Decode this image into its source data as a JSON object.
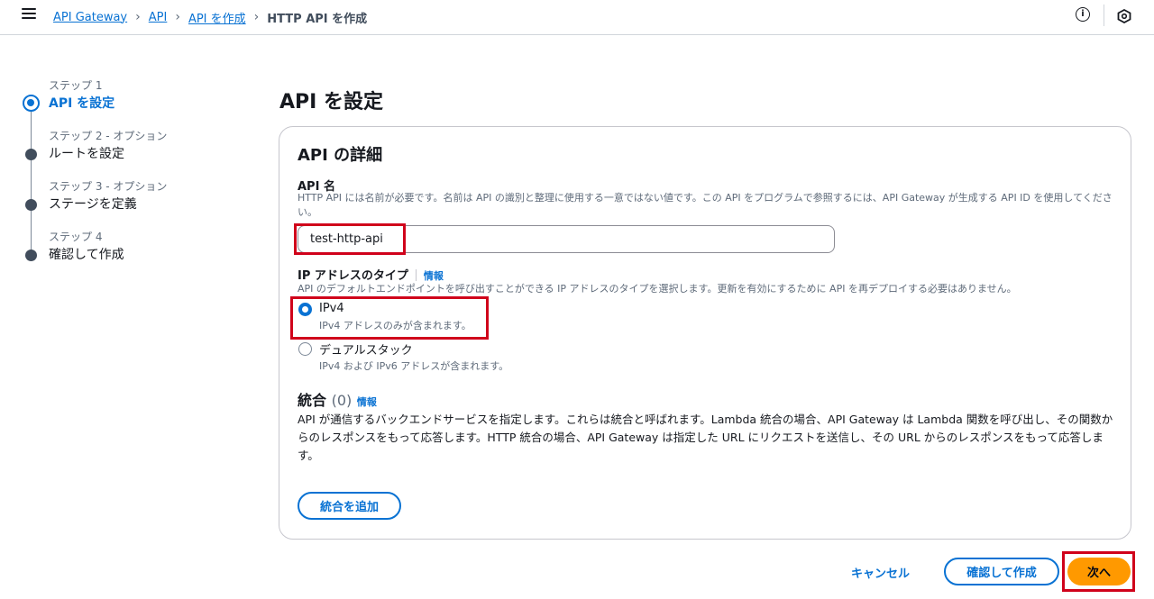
{
  "breadcrumb": {
    "items": [
      "API Gateway",
      "API",
      "API を作成"
    ],
    "current": "HTTP API を作成",
    "separator": "›"
  },
  "topbar": {
    "info_glyph": "i"
  },
  "steps": [
    {
      "sub": "ステップ 1",
      "title": "API を設定",
      "active": true
    },
    {
      "sub": "ステップ 2 - オプション",
      "title": "ルートを設定",
      "active": false
    },
    {
      "sub": "ステップ 3 - オプション",
      "title": "ステージを定義",
      "active": false
    },
    {
      "sub": "ステップ 4",
      "title": "確認して作成",
      "active": false
    }
  ],
  "main": {
    "title": "API を設定",
    "card": {
      "title": "API の詳細",
      "api_name": {
        "label": "API 名",
        "description": "HTTP API には名前が必要です。名前は API の識別と整理に使用する一意ではない値です。この API をプログラムで参照するには、API Gateway が生成する API ID を使用してください。",
        "value": "test-http-api"
      },
      "ip_type": {
        "label": "IP アドレスのタイプ",
        "info": "情報",
        "description": "API のデフォルトエンドポイントを呼び出すことができる IP アドレスのタイプを選択します。更新を有効にするために API を再デプロイする必要はありません。",
        "options": [
          {
            "label": "IPv4",
            "description": "IPv4 アドレスのみが含まれます。",
            "checked": true
          },
          {
            "label": "デュアルスタック",
            "description": "IPv4 および IPv6 アドレスが含まれます。",
            "checked": false
          }
        ]
      },
      "integrations": {
        "title": "統合",
        "count": "(0)",
        "info": "情報",
        "description": "API が通信するバックエンドサービスを指定します。これらは統合と呼ばれます。Lambda 統合の場合、API Gateway は Lambda 関数を呼び出し、その関数からのレスポンスをもって応答します。HTTP 統合の場合、API Gateway は指定した URL にリクエストを送信し、その URL からのレスポンスをもって応答します。",
        "add_button": "統合を追加"
      }
    }
  },
  "footer": {
    "cancel": "キャンセル",
    "review_create": "確認して作成",
    "next": "次へ"
  },
  "colors": {
    "accent": "#0972d3",
    "primary_button": "#ff9900",
    "highlight": "#d0021b"
  }
}
